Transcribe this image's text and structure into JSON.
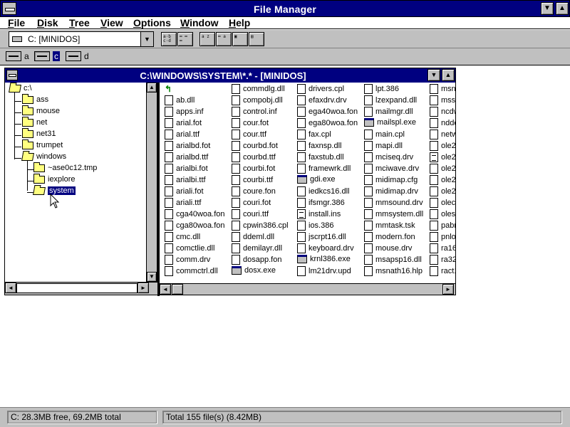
{
  "window": {
    "title": "File Manager"
  },
  "menu": [
    {
      "label": "File",
      "key": "F"
    },
    {
      "label": "Disk",
      "key": "D"
    },
    {
      "label": "Tree",
      "key": "T"
    },
    {
      "label": "View",
      "key": "V"
    },
    {
      "label": "Options",
      "key": "O"
    },
    {
      "label": "Window",
      "key": "W"
    },
    {
      "label": "Help",
      "key": "H"
    }
  ],
  "toolbar": {
    "drive_selector": "C: [MINIDOS]",
    "buttons": [
      "view-all-icon",
      "view-details-icon",
      "sort-name-icon",
      "sort-type-icon",
      "copy-icon",
      "move-icon"
    ]
  },
  "drives": [
    {
      "label": "a",
      "active": false
    },
    {
      "label": "c",
      "active": true
    },
    {
      "label": "d",
      "active": false
    }
  ],
  "doc": {
    "title": "C:\\WINDOWS\\SYSTEM\\*.* - [MINIDOS]"
  },
  "tree": [
    {
      "label": "c:\\",
      "level": 0,
      "open": true
    },
    {
      "label": "ass",
      "level": 1
    },
    {
      "label": "mouse",
      "level": 1
    },
    {
      "label": "net",
      "level": 1
    },
    {
      "label": "net31",
      "level": 1
    },
    {
      "label": "trumpet",
      "level": 1
    },
    {
      "label": "windows",
      "level": 1,
      "open": true
    },
    {
      "label": "~ase0c12.tmp",
      "level": 2
    },
    {
      "label": "iexplore",
      "level": 2
    },
    {
      "label": "system",
      "level": 2,
      "selected": true,
      "open": true
    }
  ],
  "files": [
    [
      "..",
      "ab.dll",
      "apps.inf",
      "arial.fot",
      "arial.ttf",
      "arialbd.fot",
      "arialbd.ttf",
      "arialbi.fot",
      "arialbi.ttf",
      "ariali.fot",
      "ariali.ttf",
      "cga40woa.fon",
      "cga80woa.fon",
      "cmc.dll",
      "comctlie.dll",
      "comm.drv",
      "commctrl.dll"
    ],
    [
      "commdlg.dll",
      "compobj.dll",
      "control.inf",
      "cour.fot",
      "cour.ttf",
      "courbd.fot",
      "courbd.ttf",
      "courbi.fot",
      "courbi.ttf",
      "coure.fon",
      "couri.fot",
      "couri.ttf",
      "cpwin386.cpl",
      "ddeml.dll",
      "demilayr.dll",
      "dosapp.fon",
      "dosx.exe"
    ],
    [
      "drivers.cpl",
      "efaxdrv.drv",
      "ega40woa.fon",
      "ega80woa.fon",
      "fax.cpl",
      "faxnsp.dll",
      "faxstub.dll",
      "framewrk.dll",
      "gdi.exe",
      "iedkcs16.dll",
      "ifsmgr.386",
      "install.ins",
      "ios.386",
      "jscrpt16.dll",
      "keyboard.drv",
      "krnl386.exe",
      "lm21drv.upd"
    ],
    [
      "lpt.386",
      "lzexpand.dll",
      "mailmgr.dll",
      "mailspl.exe",
      "main.cpl",
      "mapi.dll",
      "mciseq.drv",
      "mciwave.drv",
      "midimap.cfg",
      "midimap.drv",
      "mmsound.drv",
      "mmsystem.dll",
      "mmtask.tsk",
      "modern.fon",
      "mouse.drv",
      "msapsp16.dll",
      "msnath16.hlp"
    ],
    [
      "msns",
      "mssfs",
      "ncdw",
      "ndde",
      "netwo",
      "ole2.d",
      "ole2.r",
      "ole2d",
      "ole2d",
      "ole2p",
      "olecli",
      "olesv",
      "pabna",
      "pnloa",
      "ra16.c",
      "ra322",
      "ract1"
    ]
  ],
  "file_types": [
    [
      "up",
      "doc",
      "doc",
      "doc",
      "doc",
      "doc",
      "doc",
      "doc",
      "doc",
      "doc",
      "doc",
      "doc",
      "doc",
      "doc",
      "doc",
      "doc",
      "doc"
    ],
    [
      "doc",
      "doc",
      "doc",
      "doc",
      "doc",
      "doc",
      "doc",
      "doc",
      "doc",
      "doc",
      "doc",
      "doc",
      "doc",
      "doc",
      "doc",
      "doc",
      "exe"
    ],
    [
      "doc",
      "doc",
      "doc",
      "doc",
      "doc",
      "doc",
      "doc",
      "doc",
      "exe",
      "doc",
      "doc",
      "txt",
      "doc",
      "doc",
      "doc",
      "exe",
      "doc"
    ],
    [
      "doc",
      "doc",
      "doc",
      "exe",
      "doc",
      "doc",
      "doc",
      "doc",
      "doc",
      "doc",
      "doc",
      "doc",
      "doc",
      "doc",
      "doc",
      "doc",
      "doc"
    ],
    [
      "doc",
      "doc",
      "doc",
      "doc",
      "doc",
      "doc",
      "txt",
      "doc",
      "doc",
      "doc",
      "doc",
      "doc",
      "doc",
      "doc",
      "doc",
      "doc",
      "doc"
    ]
  ],
  "status": {
    "free": "C: 28.3MB free,  69.2MB total",
    "total": "Total 155 file(s) (8.42MB)"
  },
  "colors": {
    "titlebar": "#000080",
    "face": "#c0c0c0",
    "selection": "#000080",
    "folder": "#ffff80"
  }
}
